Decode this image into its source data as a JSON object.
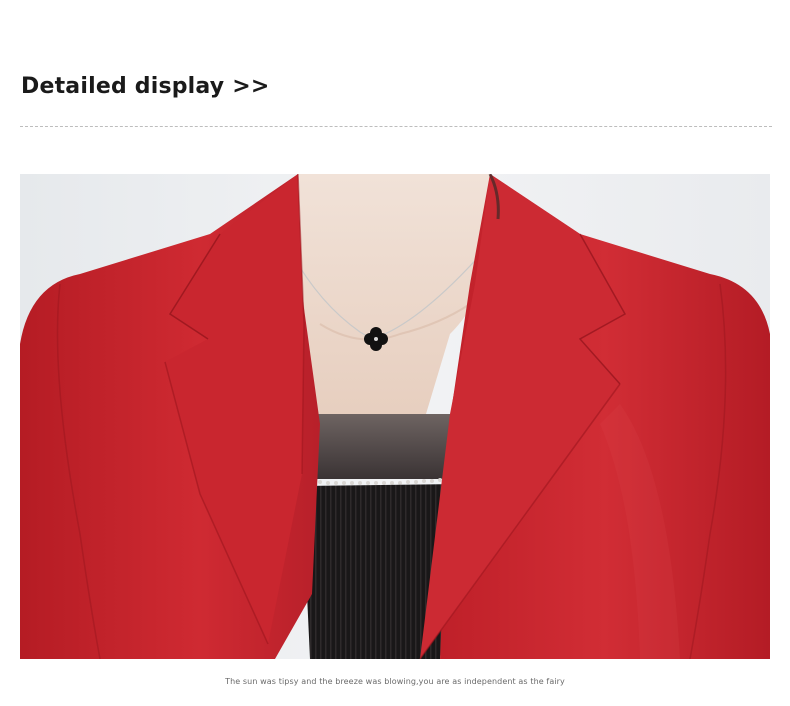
{
  "section": {
    "heading": "Detailed display >>"
  },
  "product_photo": {
    "subject": "red blazer with notched lapels over black sheer top, clover pendant necklace",
    "colors": {
      "blazer": "#c8262e",
      "top": "#1c1a1b",
      "background": "#eef0f2"
    }
  },
  "caption": {
    "text": "The sun was tipsy and the breeze was blowing,you are as independent as the fairy"
  }
}
